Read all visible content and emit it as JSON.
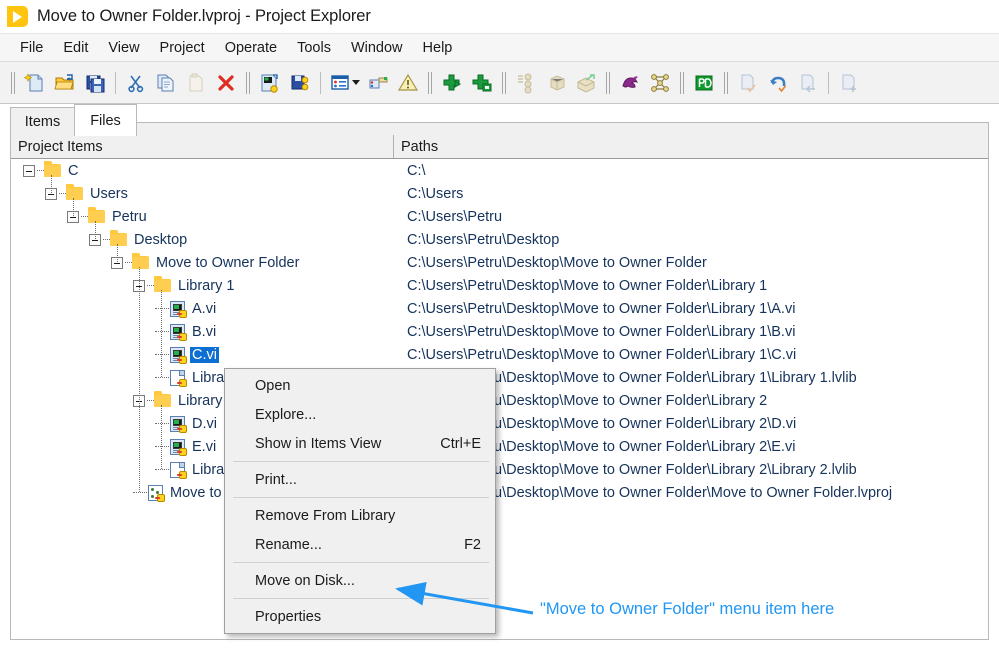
{
  "window": {
    "title": "Move to Owner Folder.lvproj - Project Explorer",
    "icon": "labview-play-icon"
  },
  "menubar": {
    "items": [
      {
        "label": "File"
      },
      {
        "label": "Edit"
      },
      {
        "label": "View"
      },
      {
        "label": "Project"
      },
      {
        "label": "Operate"
      },
      {
        "label": "Tools"
      },
      {
        "label": "Window"
      },
      {
        "label": "Help"
      }
    ]
  },
  "toolbar": {
    "groups": [
      {
        "buttons": [
          {
            "icon": "new-file-icon",
            "enabled": true
          },
          {
            "icon": "open-folder-icon",
            "enabled": true
          },
          {
            "icon": "save-all-icon",
            "enabled": true
          }
        ]
      },
      {
        "buttons": [
          {
            "icon": "cut-scissors-icon",
            "enabled": true
          },
          {
            "icon": "copy-icon",
            "enabled": true
          },
          {
            "icon": "paste-icon",
            "enabled": false
          },
          {
            "icon": "delete-x-icon",
            "enabled": true
          }
        ]
      },
      {
        "buttons": [
          {
            "icon": "run-vi-icon",
            "enabled": true
          },
          {
            "icon": "save-vi-icon",
            "enabled": true
          },
          {
            "icon": "view-list-icon",
            "enabled": true,
            "has_dropdown": true
          },
          {
            "icon": "build-spec-icon",
            "enabled": true
          },
          {
            "icon": "warning-triangle-icon",
            "enabled": true
          }
        ]
      },
      {
        "buttons": [
          {
            "icon": "add-run-icon",
            "enabled": true
          },
          {
            "icon": "add-window-icon",
            "enabled": true
          }
        ]
      },
      {
        "buttons": [
          {
            "icon": "dependencies-icon",
            "enabled": false
          },
          {
            "icon": "package-icon",
            "enabled": false
          },
          {
            "icon": "package-export-icon",
            "enabled": false
          }
        ]
      },
      {
        "buttons": [
          {
            "icon": "dragon-icon",
            "enabled": true
          },
          {
            "icon": "network-nodes-icon",
            "enabled": true
          }
        ]
      },
      {
        "buttons": [
          {
            "icon": "green-pd-icon",
            "enabled": true
          }
        ]
      },
      {
        "buttons": [
          {
            "icon": "check-doc-icon",
            "enabled": false
          },
          {
            "icon": "undo-arrow-icon",
            "enabled": true
          },
          {
            "icon": "revert-doc-icon",
            "enabled": false
          },
          {
            "icon": "add-doc-icon",
            "enabled": false
          }
        ]
      }
    ]
  },
  "tabs": {
    "items": [
      {
        "label": "Items",
        "active": false
      },
      {
        "label": "Files",
        "active": true
      }
    ]
  },
  "columns": {
    "project_items": "Project Items",
    "paths": "Paths"
  },
  "tree": {
    "rows": [
      {
        "label": "C",
        "path": "C:\\",
        "depth": 0,
        "icon": "folder-icon",
        "expander": true,
        "selected": false
      },
      {
        "label": "Users",
        "path": "C:\\Users",
        "depth": 1,
        "icon": "folder-icon",
        "expander": true,
        "selected": false
      },
      {
        "label": "Petru",
        "path": "C:\\Users\\Petru",
        "depth": 2,
        "icon": "folder-icon",
        "expander": true,
        "selected": false
      },
      {
        "label": "Desktop",
        "path": "C:\\Users\\Petru\\Desktop",
        "depth": 3,
        "icon": "folder-icon",
        "expander": true,
        "selected": false
      },
      {
        "label": "Move to Owner Folder",
        "path": "C:\\Users\\Petru\\Desktop\\Move to Owner Folder",
        "depth": 4,
        "icon": "folder-icon",
        "expander": true,
        "selected": false
      },
      {
        "label": "Library 1",
        "path": "C:\\Users\\Petru\\Desktop\\Move to Owner Folder\\Library 1",
        "depth": 5,
        "icon": "folder-icon",
        "expander": true,
        "selected": false
      },
      {
        "label": "A.vi",
        "path": "C:\\Users\\Petru\\Desktop\\Move to Owner Folder\\Library 1\\A.vi",
        "depth": 6,
        "icon": "vi-icon",
        "expander": false,
        "selected": false
      },
      {
        "label": "B.vi",
        "path": "C:\\Users\\Petru\\Desktop\\Move to Owner Folder\\Library 1\\B.vi",
        "depth": 6,
        "icon": "vi-icon",
        "expander": false,
        "selected": false
      },
      {
        "label": "C.vi",
        "path": "C:\\Users\\Petru\\Desktop\\Move to Owner Folder\\Library 1\\C.vi",
        "depth": 6,
        "icon": "vi-icon",
        "expander": false,
        "selected": true
      },
      {
        "label": "Library 1.lvlib",
        "path": "C:\\Users\\Petru\\Desktop\\Move to Owner Folder\\Library 1\\Library 1.lvlib",
        "depth": 6,
        "icon": "lvlib-icon",
        "expander": false,
        "selected": false
      },
      {
        "label": "Library 2",
        "path": "C:\\Users\\Petru\\Desktop\\Move to Owner Folder\\Library 2",
        "depth": 5,
        "icon": "folder-icon",
        "expander": true,
        "selected": false
      },
      {
        "label": "D.vi",
        "path": "C:\\Users\\Petru\\Desktop\\Move to Owner Folder\\Library 2\\D.vi",
        "depth": 6,
        "icon": "vi-icon",
        "expander": false,
        "selected": false
      },
      {
        "label": "E.vi",
        "path": "C:\\Users\\Petru\\Desktop\\Move to Owner Folder\\Library 2\\E.vi",
        "depth": 6,
        "icon": "vi-icon",
        "expander": false,
        "selected": false
      },
      {
        "label": "Library 2.lvlib",
        "path": "C:\\Users\\Petru\\Desktop\\Move to Owner Folder\\Library 2\\Library 2.lvlib",
        "depth": 6,
        "icon": "lvlib-icon",
        "expander": false,
        "selected": false
      },
      {
        "label": "Move to Owner Folder.lvproj",
        "path": "C:\\Users\\Petru\\Desktop\\Move to Owner Folder\\Move to Owner Folder.lvproj",
        "depth": 5,
        "icon": "lvproj-icon",
        "expander": false,
        "selected": false
      }
    ]
  },
  "context_menu": {
    "items": [
      {
        "label": "Open",
        "accel": "",
        "type": "item"
      },
      {
        "label": "Explore...",
        "accel": "",
        "type": "item"
      },
      {
        "label": "Show in Items View",
        "accel": "Ctrl+E",
        "type": "item"
      },
      {
        "type": "separator"
      },
      {
        "label": "Print...",
        "accel": "",
        "type": "item"
      },
      {
        "type": "separator"
      },
      {
        "label": "Remove From Library",
        "accel": "",
        "type": "item"
      },
      {
        "label": "Rename...",
        "accel": "F2",
        "type": "item"
      },
      {
        "type": "separator"
      },
      {
        "label": "Move on Disk...",
        "accel": "",
        "type": "item"
      },
      {
        "type": "separator"
      },
      {
        "label": "Properties",
        "accel": "",
        "type": "item"
      }
    ]
  },
  "annotation": {
    "text": "\"Move to Owner Folder\" menu item here",
    "color": "#2196f3"
  },
  "colors": {
    "selection_blue": "#0d6fd1",
    "tree_text": "#16335b",
    "annotation_blue": "#2196f3",
    "folder_yellow": "#FFC83D",
    "menu_bg": "#f0f0f0",
    "toolbar_bg": "#f2f2f2"
  }
}
